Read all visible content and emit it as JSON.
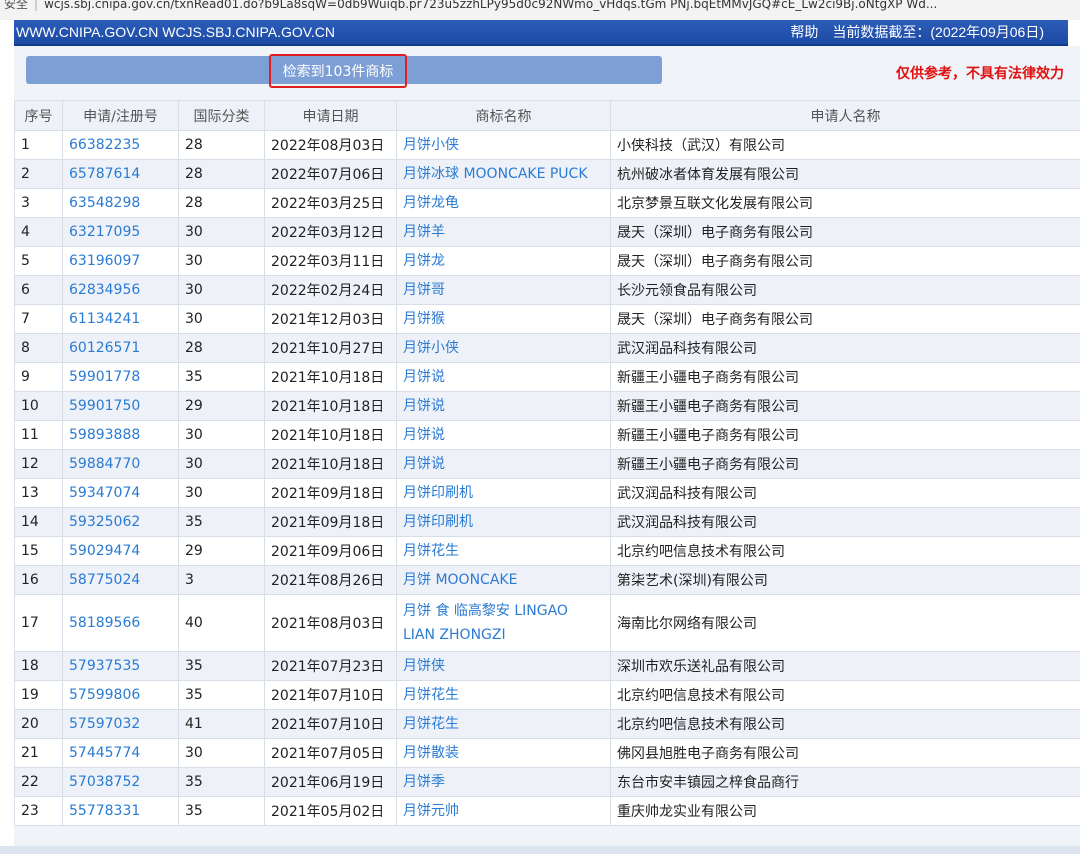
{
  "browser": {
    "secure_label": "安全",
    "url": "wcjs.sbj.cnipa.gov.cn/txnRead01.do?b9La8sqW=0db9Wuiqb.pr723u5zzhLPy95d0c92NWmo_vHdqs.tGm PNj.bqEtMMvJGQ#cE_Lw2ci9Bj.oNtgXP Wd..."
  },
  "header": {
    "site": "WWW.CNIPA.GOV.CN WCJS.SBJ.CNIPA.GOV.CN",
    "help": "帮助",
    "data_date": "当前数据截至：(2022年09月06日)"
  },
  "summary": {
    "result_count": "检索到103件商标",
    "disclaimer": "仅供参考，不具有法律效力"
  },
  "table": {
    "headers": [
      "序号",
      "申请/注册号",
      "国际分类",
      "申请日期",
      "商标名称",
      "申请人名称"
    ],
    "rows": [
      {
        "no": "1",
        "reg": "66382235",
        "cls": "28",
        "date": "2022年08月03日",
        "mark": "月饼小侠",
        "applicant": "小侠科技（武汉）有限公司"
      },
      {
        "no": "2",
        "reg": "65787614",
        "cls": "28",
        "date": "2022年07月06日",
        "mark": "月饼冰球 MOONCAKE PUCK",
        "applicant": "杭州破冰者体育发展有限公司"
      },
      {
        "no": "3",
        "reg": "63548298",
        "cls": "28",
        "date": "2022年03月25日",
        "mark": "月饼龙龟",
        "applicant": "北京梦景互联文化发展有限公司"
      },
      {
        "no": "4",
        "reg": "63217095",
        "cls": "30",
        "date": "2022年03月12日",
        "mark": "月饼羊",
        "applicant": "晟天（深圳）电子商务有限公司"
      },
      {
        "no": "5",
        "reg": "63196097",
        "cls": "30",
        "date": "2022年03月11日",
        "mark": "月饼龙",
        "applicant": "晟天（深圳）电子商务有限公司"
      },
      {
        "no": "6",
        "reg": "62834956",
        "cls": "30",
        "date": "2022年02月24日",
        "mark": "月饼哥",
        "applicant": "长沙元领食品有限公司"
      },
      {
        "no": "7",
        "reg": "61134241",
        "cls": "30",
        "date": "2021年12月03日",
        "mark": "月饼猴",
        "applicant": "晟天（深圳）电子商务有限公司"
      },
      {
        "no": "8",
        "reg": "60126571",
        "cls": "28",
        "date": "2021年10月27日",
        "mark": "月饼小侠",
        "applicant": "武汉润品科技有限公司"
      },
      {
        "no": "9",
        "reg": "59901778",
        "cls": "35",
        "date": "2021年10月18日",
        "mark": "月饼说",
        "applicant": "新疆王小疆电子商务有限公司"
      },
      {
        "no": "10",
        "reg": "59901750",
        "cls": "29",
        "date": "2021年10月18日",
        "mark": "月饼说",
        "applicant": "新疆王小疆电子商务有限公司"
      },
      {
        "no": "11",
        "reg": "59893888",
        "cls": "30",
        "date": "2021年10月18日",
        "mark": "月饼说",
        "applicant": "新疆王小疆电子商务有限公司"
      },
      {
        "no": "12",
        "reg": "59884770",
        "cls": "30",
        "date": "2021年10月18日",
        "mark": "月饼说",
        "applicant": "新疆王小疆电子商务有限公司"
      },
      {
        "no": "13",
        "reg": "59347074",
        "cls": "30",
        "date": "2021年09月18日",
        "mark": "月饼印刷机",
        "applicant": "武汉润品科技有限公司"
      },
      {
        "no": "14",
        "reg": "59325062",
        "cls": "35",
        "date": "2021年09月18日",
        "mark": "月饼印刷机",
        "applicant": "武汉润品科技有限公司"
      },
      {
        "no": "15",
        "reg": "59029474",
        "cls": "29",
        "date": "2021年09月06日",
        "mark": "月饼花生",
        "applicant": "北京约吧信息技术有限公司"
      },
      {
        "no": "16",
        "reg": "58775024",
        "cls": "3",
        "date": "2021年08月26日",
        "mark": "月饼 MOONCAKE",
        "applicant": "第柒艺术(深圳)有限公司"
      },
      {
        "no": "17",
        "reg": "58189566",
        "cls": "40",
        "date": "2021年08月03日",
        "mark": "月饼 食 临高黎安 LINGAO LIAN ZHONGZI",
        "applicant": "海南比尔网络有限公司"
      },
      {
        "no": "18",
        "reg": "57937535",
        "cls": "35",
        "date": "2021年07月23日",
        "mark": "月饼侠",
        "applicant": "深圳市欢乐送礼品有限公司"
      },
      {
        "no": "19",
        "reg": "57599806",
        "cls": "35",
        "date": "2021年07月10日",
        "mark": "月饼花生",
        "applicant": "北京约吧信息技术有限公司"
      },
      {
        "no": "20",
        "reg": "57597032",
        "cls": "41",
        "date": "2021年07月10日",
        "mark": "月饼花生",
        "applicant": "北京约吧信息技术有限公司"
      },
      {
        "no": "21",
        "reg": "57445774",
        "cls": "30",
        "date": "2021年07月05日",
        "mark": "月饼散装",
        "applicant": "佛冈县旭胜电子商务有限公司"
      },
      {
        "no": "22",
        "reg": "57038752",
        "cls": "35",
        "date": "2021年06月19日",
        "mark": "月饼季",
        "applicant": "东台市安丰镇园之梓食品商行"
      },
      {
        "no": "23",
        "reg": "55778331",
        "cls": "35",
        "date": "2021年05月02日",
        "mark": "月饼元帅",
        "applicant": "重庆帅龙实业有限公司"
      }
    ]
  }
}
